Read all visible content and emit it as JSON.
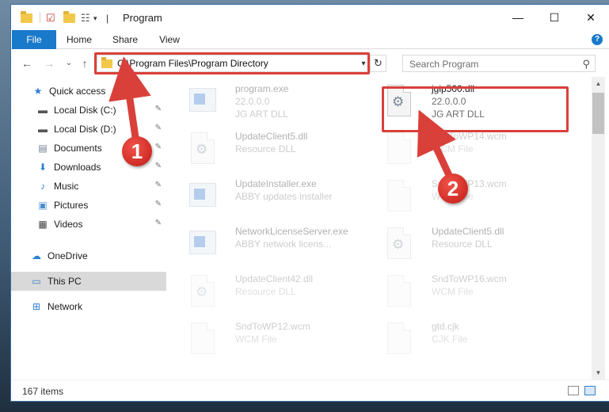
{
  "window": {
    "title": "Program",
    "minimize": "—",
    "maximize": "☐",
    "close": "✕"
  },
  "ribbon": {
    "tabs": [
      "File",
      "Home",
      "Share",
      "View"
    ],
    "help": "?"
  },
  "address_bar": {
    "path": "C:\\Program Files\\Program Directory",
    "dropdown": "▾",
    "refresh": "↻"
  },
  "search": {
    "placeholder": "Search Program",
    "icon": "⚲"
  },
  "nav_buttons": {
    "back": "←",
    "forward": "→",
    "recent": "⌄",
    "up": "↑"
  },
  "nav_pane": {
    "items": [
      {
        "label": "Quick access",
        "icon": "star-icon",
        "glyph": "★",
        "color": "#2c7fd6"
      },
      {
        "label": "Local Disk (C:)",
        "icon": "drive-icon",
        "glyph": "▬",
        "color": "#555555",
        "pinned": true
      },
      {
        "label": "Local Disk (D:)",
        "icon": "drive-icon",
        "glyph": "▬",
        "color": "#555555",
        "pinned": true
      },
      {
        "label": "Documents",
        "icon": "documents-icon",
        "glyph": "▤",
        "color": "#6b7b8c",
        "pinned": true
      },
      {
        "label": "Downloads",
        "icon": "downloads-icon",
        "glyph": "⬇",
        "color": "#2c7fd6",
        "pinned": true
      },
      {
        "label": "Music",
        "icon": "music-icon",
        "glyph": "♪",
        "color": "#2c7fd6",
        "pinned": true
      },
      {
        "label": "Pictures",
        "icon": "pictures-icon",
        "glyph": "▣",
        "color": "#4a8fcf",
        "pinned": true
      },
      {
        "label": "Videos",
        "icon": "videos-icon",
        "glyph": "▦",
        "color": "#444444",
        "pinned": true
      },
      {
        "label": "OneDrive",
        "icon": "cloud-icon",
        "glyph": "☁",
        "color": "#2c7fd6"
      },
      {
        "label": "This PC",
        "icon": "computer-icon",
        "glyph": "▭",
        "color": "#3a7fc4",
        "selected": true
      },
      {
        "label": "Network",
        "icon": "network-icon",
        "glyph": "⊞",
        "color": "#2c7fd6"
      }
    ],
    "pin_glyph": "✎"
  },
  "files": [
    {
      "name": "program.exe",
      "line1": "22.0.0.0",
      "line2": "JG ART DLL",
      "kind": "exe"
    },
    {
      "name": "jgip500.dll",
      "line1": "22.0.0.0",
      "line2": "JG ART DLL",
      "kind": "dll",
      "highlighted": true
    },
    {
      "name": "UpdateClient5.dll",
      "line1": "Resource DLL",
      "line2": "",
      "kind": "dll"
    },
    {
      "name": "SndToWP14.wcm",
      "line1": "WCM File",
      "line2": "",
      "kind": "doc"
    },
    {
      "name": "UpdateInstaller.exe",
      "line1": "ABBY updates installer",
      "line2": "",
      "kind": "exe"
    },
    {
      "name": "SndToWP13.wcm",
      "line1": "WCM File",
      "line2": "",
      "kind": "doc"
    },
    {
      "name": "NetworkLicenseServer.exe",
      "line1": "ABBY network licens...",
      "line2": "",
      "kind": "exe"
    },
    {
      "name": "UpdateClient5.dll",
      "line1": "Resource DLL",
      "line2": "",
      "kind": "dll"
    },
    {
      "name": "UpdateClient42.dll",
      "line1": "Resource DLL",
      "line2": "",
      "kind": "dll"
    },
    {
      "name": "SndToWP16.wcm",
      "line1": "WCM File",
      "line2": "",
      "kind": "doc"
    },
    {
      "name": "SndToWP12.wcm",
      "line1": "WCM File",
      "line2": "",
      "kind": "doc"
    },
    {
      "name": "gtd.cjk",
      "line1": "CJK File",
      "line2": "",
      "kind": "doc"
    }
  ],
  "status": {
    "count": "167 items"
  },
  "callouts": [
    "1",
    "2"
  ],
  "colors": {
    "accent": "#1979ca",
    "highlight": "#d9403a"
  }
}
